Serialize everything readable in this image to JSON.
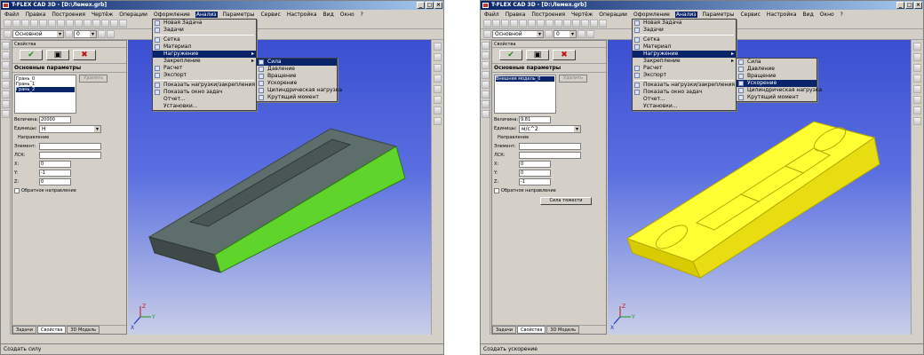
{
  "left_window": {
    "title": "T-FLEX CAD 3D - [D:\\Лемех.grb]",
    "menu": [
      "Файл",
      "Правка",
      "Построения",
      "Чертёж",
      "Операции",
      "Оформление",
      "Анализ",
      "Параметры",
      "Сервис",
      "Настройка",
      "Вид",
      "Окно",
      "?"
    ],
    "open_menu_index": 6,
    "layer_combo": "Основной",
    "zero_combo": "0",
    "panel": {
      "header": "Свойства",
      "section_title": "Основные параметры",
      "list_items": [
        "Грань_0",
        "Грань_1",
        "Грань_2"
      ],
      "selected_list_index": 2,
      "remove_button": "Удалить",
      "value_label": "Величина:",
      "value": "20000",
      "units_label": "Единицы:",
      "units_value": "Н",
      "direction_label": "Направление",
      "element_label": "Элемент:",
      "lcs_label": "ЛСК:",
      "x_label": "X:",
      "x_value": "0",
      "y_label": "Y:",
      "y_value": "-1",
      "z_label": "Z:",
      "z_value": "0",
      "reverse_label": "Обратное направление",
      "tabs": [
        "Задачи",
        "Свойства",
        "3D Модель"
      ]
    },
    "analysis_menu": [
      "Новая Задача",
      "Задачи",
      "Сетка",
      "Материал",
      "Нагружение",
      "Закрепление",
      "Расчет",
      "Экспорт",
      "Показать нагрузки/закрепления",
      "Показать окно задач",
      "Отчет...",
      "Установки..."
    ],
    "analysis_highlight": 4,
    "load_submenu": [
      "Сила",
      "Давление",
      "Вращение",
      "Ускорение",
      "Цилиндрическая нагрузка",
      "Крутящий момент"
    ],
    "load_highlight": 0,
    "status": "Создать силу"
  },
  "right_window": {
    "title": "T-FLEX CAD 3D - [D:\\Лемех.grb]",
    "menu": [
      "Файл",
      "Правка",
      "Построения",
      "Чертёж",
      "Операции",
      "Оформление",
      "Анализ",
      "Параметры",
      "Сервис",
      "Настройка",
      "Вид",
      "Окно",
      "?"
    ],
    "open_menu_index": 6,
    "layer_combo": "Основной",
    "zero_combo": "0",
    "panel": {
      "header": "Свойства",
      "section_title": "Основные параметры",
      "list_items": [
        "Внешняя модель_0"
      ],
      "selected_list_index": 0,
      "remove_button": "Удалить",
      "value_label": "Величина:",
      "value": "9.81",
      "units_label": "Единицы:",
      "units_value": "м/с^2",
      "direction_label": "Направление",
      "element_label": "Элемент:",
      "lcs_label": "ЛСК:",
      "x_label": "X:",
      "x_value": "0",
      "y_label": "Y:",
      "y_value": "0",
      "z_label": "Z:",
      "z_value": "-1",
      "reverse_label": "Обратное направление",
      "gravity_button": "Сила тяжести",
      "tabs": [
        "Задачи",
        "Свойства",
        "3D Модель"
      ]
    },
    "analysis_menu": [
      "Новая Задача",
      "Задачи",
      "Сетка",
      "Материал",
      "Нагружение",
      "Закрепление",
      "Расчет",
      "Экспорт",
      "Показать нагрузки/закрепления",
      "Показать окно задач",
      "Отчет...",
      "Установки..."
    ],
    "analysis_highlight": 4,
    "load_submenu": [
      "Сила",
      "Давление",
      "Вращение",
      "Ускорение",
      "Цилиндрическая нагрузка",
      "Крутящий момент"
    ],
    "load_highlight": 3,
    "status": "Создать ускорение"
  },
  "colors": {
    "selection": "#0a246a",
    "model_grey": "#5e6e6a",
    "model_green": "#5fd42a",
    "model_yellow": "#ffff33",
    "viewport_top": "#3a4fd1"
  },
  "axes": {
    "x": "X",
    "y": "Y",
    "z": "Z"
  }
}
